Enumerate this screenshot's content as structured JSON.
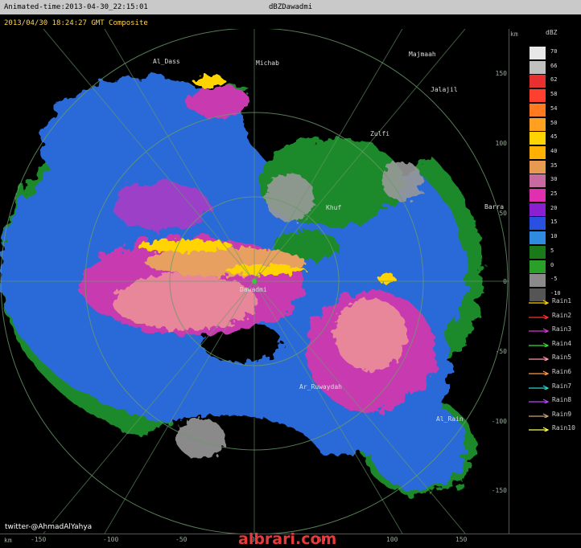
{
  "topbar": {
    "anim_label": "Animated-time:2013-04-30_22:15:01",
    "product": "dBZDawadmi"
  },
  "header": {
    "datetime": "2013/04/30 18:24:27 GMT Composite"
  },
  "axes": {
    "unit": "km",
    "y_ticks": [
      "150",
      "100",
      "50",
      "0",
      "-50",
      "-100",
      "-150"
    ],
    "x_ticks": [
      "-150",
      "-100",
      "-50",
      "0",
      "50",
      "100",
      "150"
    ]
  },
  "places": [
    "Al_Dass",
    "Michab",
    "Majmaah",
    "Jalajil",
    "Zulfi",
    "Khuf",
    "Barra",
    "Dawadmi",
    "Ar_Ruwaydah",
    "Al_Rain"
  ],
  "ring_labels": [
    "150",
    "100",
    "50",
    "150",
    "100",
    "150",
    "100",
    "150",
    "100",
    "50",
    "150"
  ],
  "legend": {
    "title": "dBZ",
    "levels": [
      {
        "v": "70",
        "c": "#e8e8e8"
      },
      {
        "v": "66",
        "c": "#c0c0c0"
      },
      {
        "v": "62",
        "c": "#e83030"
      },
      {
        "v": "58",
        "c": "#ff4030"
      },
      {
        "v": "54",
        "c": "#ff7a20"
      },
      {
        "v": "50",
        "c": "#ffa020"
      },
      {
        "v": "45",
        "c": "#ffd400"
      },
      {
        "v": "40",
        "c": "#ffb000"
      },
      {
        "v": "35",
        "c": "#e89a50"
      },
      {
        "v": "30",
        "c": "#c86aa0"
      },
      {
        "v": "25",
        "c": "#e030b0"
      },
      {
        "v": "20",
        "c": "#8a20d0"
      },
      {
        "v": "15",
        "c": "#2a50e0"
      },
      {
        "v": "10",
        "c": "#2f8ae0"
      },
      {
        "v": "5",
        "c": "#1a7a1a"
      },
      {
        "v": "0",
        "c": "#2aa02a"
      },
      {
        "v": "-5",
        "c": "#8a8a8a"
      },
      {
        "v": "-10",
        "c": "#555555"
      }
    ],
    "rain": [
      {
        "name": "Rain1",
        "c": "#ffd400"
      },
      {
        "name": "Rain2",
        "c": "#ff3030"
      },
      {
        "name": "Rain3",
        "c": "#e030e0"
      },
      {
        "name": "Rain4",
        "c": "#30e030"
      },
      {
        "name": "Rain5",
        "c": "#ff9ab0"
      },
      {
        "name": "Rain6",
        "c": "#ff9a40"
      },
      {
        "name": "Rain7",
        "c": "#30d0d0"
      },
      {
        "name": "Rain8",
        "c": "#c040ff"
      },
      {
        "name": "Rain9",
        "c": "#d0a070"
      },
      {
        "name": "Rain10",
        "c": "#ffff50"
      }
    ]
  },
  "footer": {
    "twitter": "twitter-@AhmadAlYahya",
    "watermark": "albrari.com"
  }
}
